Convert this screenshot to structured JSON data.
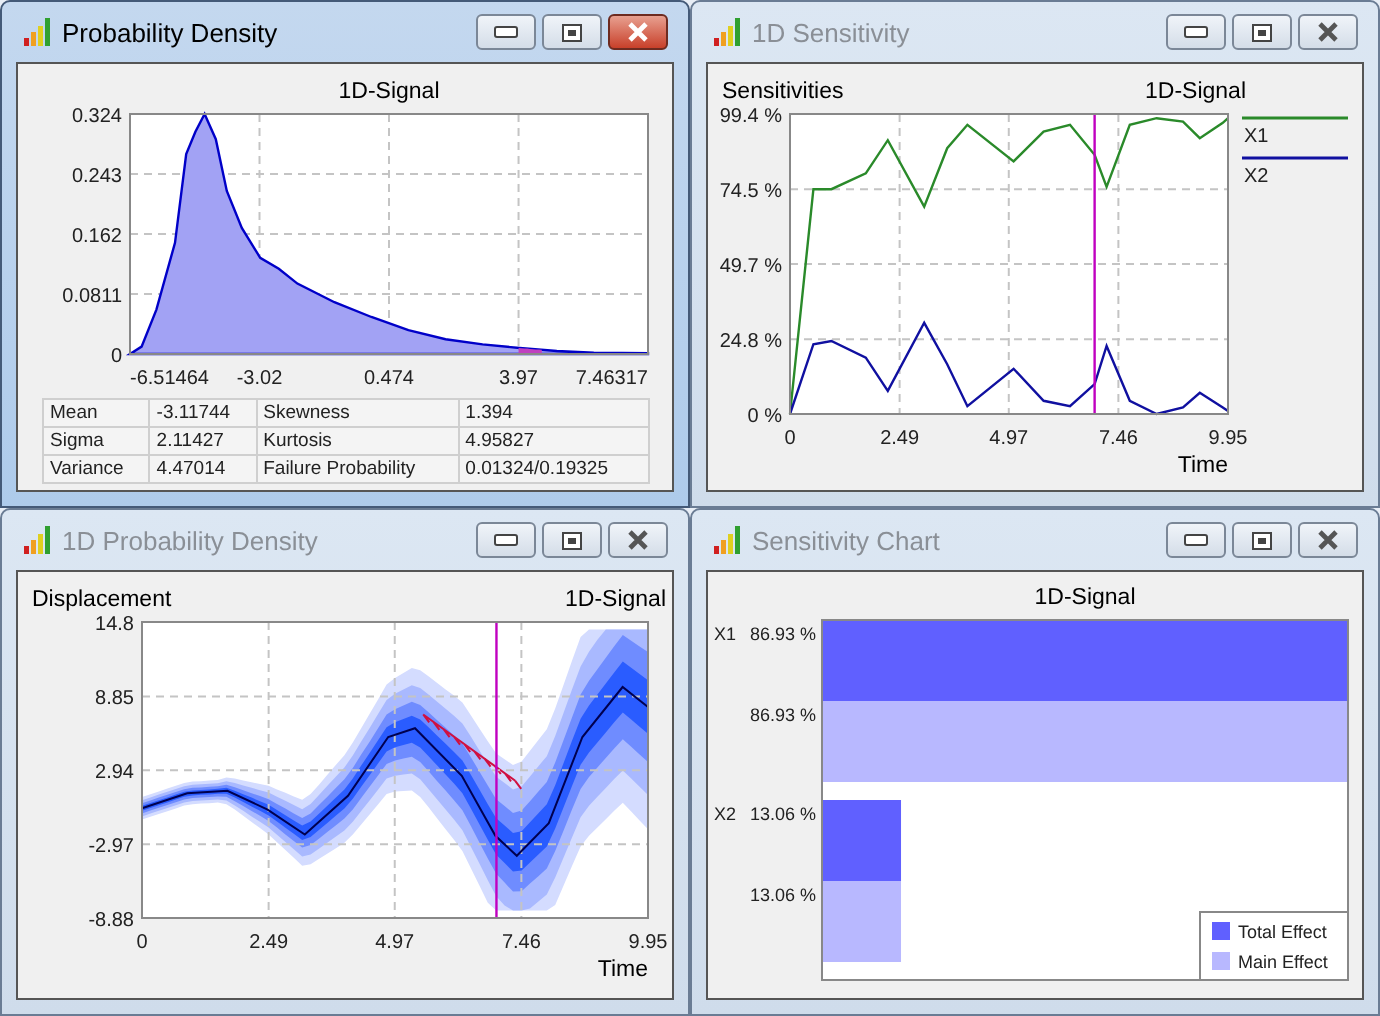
{
  "windows": [
    {
      "title": "Probability Density",
      "active": true,
      "kind": "density",
      "chart_data": {
        "type": "area",
        "title": "1D-Signal",
        "x": [
          -6.51464,
          -6.2,
          -5.8,
          -5.3,
          -5.0,
          -4.75,
          -4.5,
          -4.2,
          -3.9,
          -3.5,
          -3.0,
          -2.5,
          -2.0,
          -1.0,
          0,
          1,
          2,
          3,
          4,
          5,
          6,
          7.46317
        ],
        "values": [
          0,
          0.01,
          0.06,
          0.15,
          0.27,
          0.3,
          0.324,
          0.29,
          0.22,
          0.17,
          0.13,
          0.115,
          0.095,
          0.07,
          0.05,
          0.032,
          0.02,
          0.013,
          0.008,
          0.004,
          0.002,
          0.001
        ],
        "xlim": [
          -6.51464,
          7.46317
        ],
        "ylim": [
          0,
          0.324
        ],
        "xticks": [
          -6.51464,
          -3.02,
          0.474,
          3.97,
          7.46317
        ],
        "yticks": [
          0,
          0.0811,
          0.162,
          0.243,
          0.324
        ],
        "grid": true
      },
      "stats": [
        {
          "cells": [
            "Mean",
            "-3.11744",
            "Skewness",
            "1.394"
          ]
        },
        {
          "cells": [
            "Sigma",
            "2.11427",
            "Kurtosis",
            "4.95827"
          ]
        },
        {
          "cells": [
            "Variance",
            "4.47014",
            "Failure Probability",
            "0.01324/0.19325"
          ]
        }
      ]
    },
    {
      "title": "1D Sensitivity",
      "active": false,
      "kind": "sensitivity",
      "chart_data": {
        "type": "line",
        "title": "1D-Signal",
        "ylabel": "Sensitivities",
        "xlabel": "Time",
        "x": [
          0,
          0.53,
          0.94,
          1.72,
          2.22,
          3.05,
          3.57,
          4.03,
          5.08,
          5.76,
          6.36,
          6.92,
          7.19,
          7.72,
          8.33,
          8.93,
          9.31,
          9.83,
          9.95
        ],
        "series": [
          {
            "name": "X1",
            "color": "#2a8a2a",
            "values": [
              0,
              74.5,
              74.5,
              79.7,
              90.7,
              68.7,
              88.1,
              95.8,
              83.7,
              93.6,
              95.8,
              85.9,
              75.3,
              95.8,
              98,
              96.9,
              91.4,
              96.5,
              98
            ]
          },
          {
            "name": "X2",
            "color": "#1010a0",
            "values": [
              0,
              23.1,
              24.2,
              18.7,
              7.7,
              30.2,
              16.5,
              2.6,
              15,
              4.4,
              2.6,
              9.9,
              22.5,
              4.4,
              0,
              2.2,
              7,
              2.2,
              1
            ]
          }
        ],
        "xlim": [
          0,
          9.95
        ],
        "ylim": [
          0,
          99.4
        ],
        "xticks": [
          0,
          2.49,
          4.97,
          7.46,
          9.95
        ],
        "yticks": [
          {
            "value": 0,
            "label": "0 %"
          },
          {
            "value": 24.8,
            "label": "24.8 %"
          },
          {
            "value": 49.7,
            "label": "49.7 %"
          },
          {
            "value": 74.5,
            "label": "74.5 %"
          },
          {
            "value": 99.4,
            "label": "99.4 %"
          }
        ],
        "grid": true,
        "legend": "right",
        "ref_lines": [
          {
            "axis": "x",
            "value": 6.92,
            "color": "#c000c0"
          }
        ]
      }
    },
    {
      "title": "1D Probability Density",
      "active": false,
      "kind": "density_band",
      "chart_data": {
        "type": "line",
        "title": "1D-Signal",
        "ylabel": "Displacement",
        "xlabel": "Time",
        "x": [
          0,
          0.89,
          1.68,
          2.47,
          3.2,
          4.05,
          4.84,
          5.37,
          6.29,
          6.95,
          7.37,
          8.0,
          8.66,
          9.45,
          9.95
        ],
        "values": [
          -0.1,
          1.1,
          1.3,
          -0.2,
          -2.2,
          0.9,
          5.6,
          6.3,
          2.5,
          -2.3,
          -3.9,
          -1.3,
          5.6,
          9.6,
          8.0
        ],
        "xlim": [
          0,
          9.95
        ],
        "ylim": [
          -8.88,
          14.8
        ],
        "xticks": [
          0,
          2.49,
          4.97,
          7.46,
          9.95
        ],
        "yticks": [
          -8.88,
          -2.97,
          2.94,
          8.85,
          14.8
        ],
        "grid": true,
        "ref_lines": [
          {
            "axis": "x",
            "value": 6.97,
            "color": "#c000c0"
          }
        ]
      }
    },
    {
      "title": "Sensitivity Chart",
      "active": false,
      "kind": "bar",
      "chart_data": {
        "type": "bar",
        "orientation": "horizontal",
        "title": "1D-Signal",
        "categories": [
          "X1",
          "X2"
        ],
        "series": [
          {
            "name": "Total Effect",
            "color": "#6060ff",
            "values": [
              86.93,
              13.06
            ],
            "value_labels": [
              "86.93 %",
              "13.06 %"
            ]
          },
          {
            "name": "Main Effect",
            "color": "#b8b8ff",
            "values": [
              86.93,
              13.06
            ],
            "value_labels": [
              "86.93 %",
              "13.06 %"
            ]
          }
        ],
        "legend": "lower right"
      }
    }
  ]
}
